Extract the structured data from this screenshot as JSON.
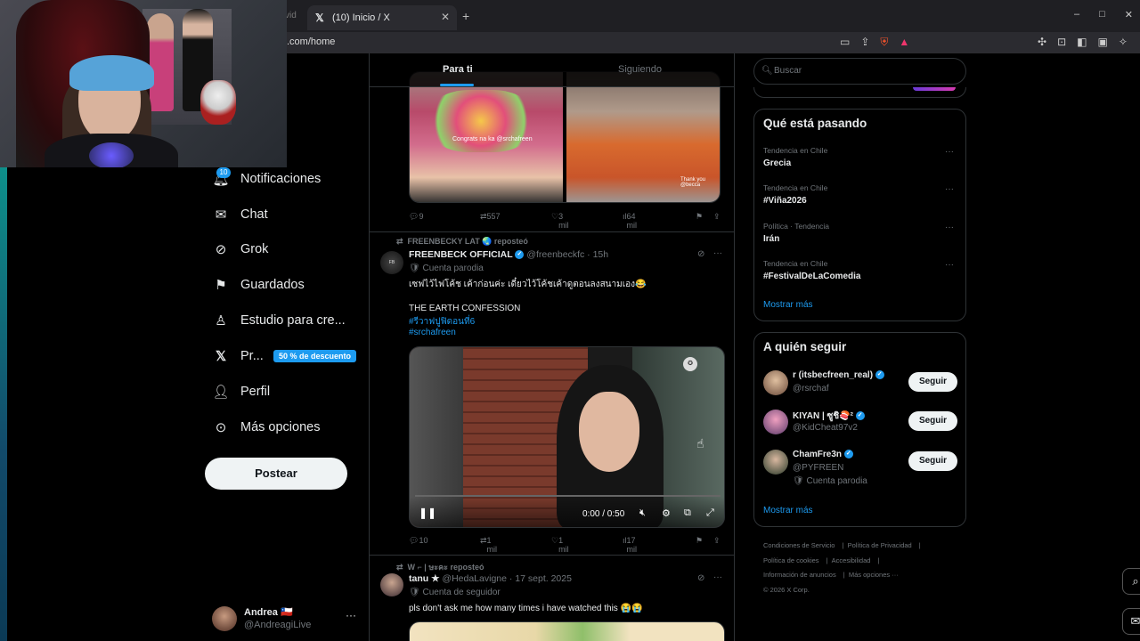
{
  "browser": {
    "tab_title": "(10) Inicio / X",
    "prev_tab_fragment": "vid",
    "url": ".com/home",
    "new_tab": "+",
    "min": "–",
    "max": "□",
    "close": "✕"
  },
  "nav": {
    "notifications": "Notificaciones",
    "notifications_badge": "10",
    "chat": "Chat",
    "grok": "Grok",
    "saved": "Guardados",
    "studio": "Estudio para cre...",
    "premium": "Pr...",
    "premium_promo": "50 % de descuento",
    "profile": "Perfil",
    "more": "Más opciones",
    "post_button": "Postear"
  },
  "account": {
    "name": "Andrea 🇨🇱",
    "handle": "@AndreagiLive",
    "more": "···"
  },
  "timeline": {
    "tab_for_you": "Para ti",
    "tab_following": "Siguiendo",
    "tweet1": {
      "replies": "9",
      "reposts": "557",
      "likes": "3 mil",
      "views": "64 mil",
      "image_caption_left": "Congrats na ka @srchafreen",
      "image_caption_right": "Thank you @becca"
    },
    "tweet2": {
      "reposted_by": "FREENBECKY LAT 🌏 reposteó",
      "name": "FREENBECK OFFICIAL",
      "handle": "@freenbeckfc · 15h",
      "sub": "🛡 Cuenta parodia",
      "text_thai": "เซฟไว้ไฟโค้ช เค้าก่อนค่ะ เดี๋ยวไว้โค้ชเค้าดูตอนลงสนามเอง😂",
      "text_title": "THE EARTH CONFESSION",
      "hashtag1": "#รีวาฟปูฟิดอนที่6",
      "hashtag2": "#srchafreen",
      "video_time": "0:00 / 0:50",
      "replies": "10",
      "reposts": "1 mil",
      "likes": "1 mil",
      "views": "17 mil"
    },
    "tweet3": {
      "reposted_by": "W ⌐ | ษะคะ reposteó",
      "name": "tanu ★",
      "handle": "@HedaLavigne · 17 sept. 2025",
      "sub": "🛡 Cuenta de seguidor",
      "text": "pls don't ask me how many times i have watched this 😭😭"
    }
  },
  "right": {
    "search_placeholder": "Buscar",
    "trends_title": "Qué está pasando",
    "trends": [
      {
        "context": "Tendencia en Chile",
        "name": "Grecia"
      },
      {
        "context": "Tendencia en Chile",
        "name": "#Viña2026"
      },
      {
        "context": "Política · Tendencia",
        "name": "Irán"
      },
      {
        "context": "Tendencia en Chile",
        "name": "#FestivalDeLaComedia"
      }
    ],
    "trends_more": "Mostrar más",
    "follow_title": "A quién seguir",
    "follow": [
      {
        "name": "r (itsbecfreen_real)",
        "handle": "@rsrchaf",
        "button": "Seguir",
        "sub": ""
      },
      {
        "name": "KIYAN | ซูชิ🍣²",
        "handle": "@KidCheat97v2",
        "button": "Seguir",
        "sub": ""
      },
      {
        "name": "ChamFre3n",
        "handle": "@PYFREEN",
        "button": "Seguir",
        "sub": "🛡 Cuenta parodia"
      }
    ],
    "follow_more": "Mostrar más",
    "footer": {
      "terms": "Condiciones de Servicio",
      "privacy": "Política de Privacidad",
      "cookies": "Política de cookies",
      "accessibility": "Accesibilidad",
      "ads": "Información de anuncios",
      "more": "Más opciones ···",
      "copyright": "© 2026 X Corp."
    }
  },
  "colors": {
    "accent": "#1d9bf0",
    "background": "#000000",
    "border": "#2f3336",
    "muted": "#71767b"
  }
}
